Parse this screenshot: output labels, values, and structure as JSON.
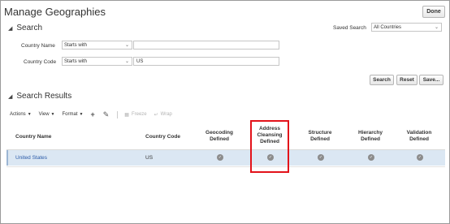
{
  "header": {
    "title": "Manage Geographies",
    "done_label": "Done"
  },
  "search": {
    "section_title": "Search",
    "saved_search_label": "Saved Search",
    "saved_search_value": "All Countries",
    "country_name": {
      "label": "Country Name",
      "operator": "Starts with",
      "value": ""
    },
    "country_code": {
      "label": "Country Code",
      "operator": "Starts with",
      "value": "US"
    },
    "buttons": {
      "search": "Search",
      "reset": "Reset",
      "save": "Save..."
    }
  },
  "results": {
    "section_title": "Search Results",
    "toolbar": {
      "actions": "Actions",
      "view": "View",
      "format": "Format",
      "freeze": "Freeze",
      "wrap": "Wrap"
    },
    "columns": {
      "country_name": "Country Name",
      "country_code": "Country Code",
      "geocoding": [
        "Geocoding",
        "Defined"
      ],
      "address_cleansing": [
        "Address",
        "Cleansing",
        "Defined"
      ],
      "structure": [
        "Structure",
        "Defined"
      ],
      "hierarchy": [
        "Hierarchy",
        "Defined"
      ],
      "validation": [
        "Validation",
        "Defined"
      ]
    },
    "rows": [
      {
        "country_name": "United States",
        "country_code": "US"
      }
    ]
  },
  "icons": {
    "check": "✓",
    "add": "+",
    "edit": "✎",
    "triangle_down": "◢",
    "chevron": "⌄",
    "caret": "▼"
  },
  "colors": {
    "highlight": "#e3121a",
    "selected_row": "#dbe7f3",
    "link": "#2a5aa8"
  }
}
